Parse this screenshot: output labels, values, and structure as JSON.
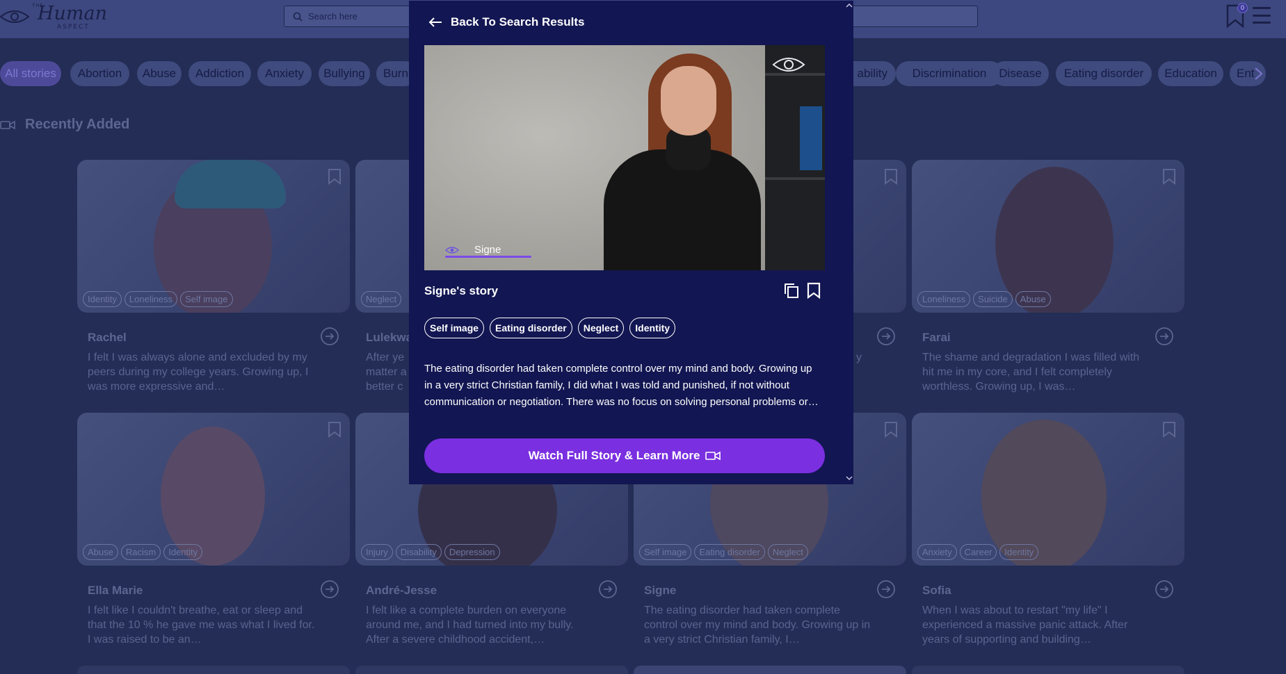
{
  "header": {
    "logo": {
      "top": "THE",
      "main": "Human",
      "sub": "ASPECT"
    },
    "search": {
      "placeholder": "Search here"
    },
    "bookmark_count": "0"
  },
  "tags": [
    "All stories",
    "Abortion",
    "Abuse",
    "Addiction",
    "Anxiety",
    "Bullying",
    "Burn",
    "ability",
    "Discrimination",
    "Disease",
    "Eating disorder",
    "Education",
    "Ent"
  ],
  "section": {
    "title": "Recently Added"
  },
  "cards": [
    {
      "name": "Rachel",
      "tags": [
        "Identity",
        "Loneliness",
        "Self image"
      ],
      "text": "I felt I was always alone and excluded by my peers during my college years. Growing up, I was more expressive and…"
    },
    {
      "name": "Lulekwa",
      "tags": [
        "Neglect"
      ],
      "text": "After ye matter a better c"
    },
    {
      "name": "",
      "tags": [],
      "text": "y"
    },
    {
      "name": "Farai",
      "tags": [
        "Loneliness",
        "Suicide",
        "Abuse"
      ],
      "text": "The shame and degradation I was filled with hit me in my core, and I felt completely worthless. Growing up, I was…"
    },
    {
      "name": "Ella Marie",
      "tags": [
        "Abuse",
        "Racism",
        "Identity"
      ],
      "text": "I felt like I couldn't breathe, eat or sleep and that the 10 % he gave me was what I lived for. I was raised to be an…"
    },
    {
      "name": "André-Jesse",
      "tags": [
        "Injury",
        "Disability",
        "Depression"
      ],
      "text": "I felt like a complete burden on everyone around me, and I had turned into my bully. After a severe childhood accident,…"
    },
    {
      "name": "Signe",
      "tags": [
        "Self image",
        "Eating disorder",
        "Neglect"
      ],
      "text": "The eating disorder had taken complete control over my mind and body. Growing up in a very strict Christian family, I…"
    },
    {
      "name": "Sofia",
      "tags": [
        "Anxiety",
        "Career",
        "Identity"
      ],
      "text": "When I was about to restart \"my life\" I experienced a massive panic attack. After years of supporting and building…"
    }
  ],
  "modal": {
    "back_label": "Back To Search Results",
    "video_caption": "Signe",
    "story_title": "Signe's story",
    "tags": [
      "Self image",
      "Eating disorder",
      "Neglect",
      "Identity"
    ],
    "text": "The eating disorder had taken complete control over my mind and body. Growing up in a very strict Christian family, I did what I was told and punished, if not without communication or negotiation. There was no focus on solving personal problems or…",
    "watch_label": "Watch Full Story & Learn More"
  },
  "colors": {
    "accent": "#7a2fe0",
    "modal_bg": "#121652",
    "page_bg": "#232d55"
  },
  "icons": [
    "eye-logo-icon",
    "search-icon",
    "bookmark-icon",
    "menu-icon",
    "chevron-right-icon",
    "video-camera-icon",
    "arrow-left-icon",
    "copy-icon",
    "arrow-right-circle-icon",
    "chevron-up-icon",
    "chevron-down-icon"
  ]
}
